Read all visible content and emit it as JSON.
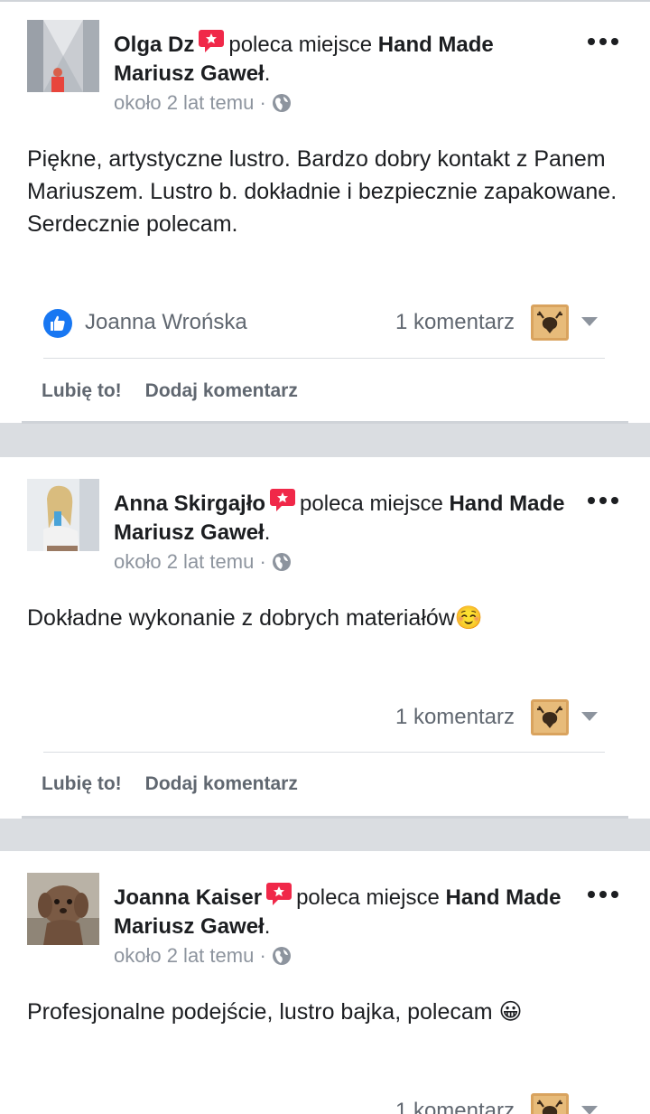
{
  "posts": [
    {
      "author": "Olga Dz",
      "recommends": "poleca miejsce",
      "page": "Hand Made Mariusz Gaweł",
      "time": "około 2 lat temu",
      "text": "Piękne, artystyczne lustro. Bardzo dobry kontakt z Panem Mariuszem. Lustro b. dokładnie i bezpiecznie zapakowane. Serdecznie polecam.",
      "reactor": "Joanna Wrońska",
      "comments": "1 komentarz"
    },
    {
      "author": "Anna Skirgajło",
      "recommends": "poleca miejsce",
      "page": "Hand Made Mariusz Gaweł",
      "time": "około 2 lat temu",
      "text": "Dokładne wykonanie z dobrych materiałów☺️",
      "reactor": "",
      "comments": "1 komentarz"
    },
    {
      "author": "Joanna Kaiser",
      "recommends": "poleca miejsce",
      "page": "Hand Made Mariusz Gaweł",
      "time": "około 2 lat temu",
      "text": "Profesjonalne podejście, lustro bajka, polecam 😀",
      "reactor": "",
      "comments": "1 komentarz"
    }
  ],
  "actions": {
    "like": "Lubię to!",
    "comment": "Dodaj komentarz"
  },
  "separators": {
    "dot": "·",
    "period": "."
  },
  "colors": {
    "badge": "#f02849",
    "like": "#1877f2",
    "muted": "#606770",
    "meta": "#8d949e",
    "feed_bg": "#dadde1"
  },
  "icons": [
    "recommendation-badge-icon",
    "globe-icon",
    "more-options-icon",
    "like-reaction-icon",
    "page-thumbnail-icon",
    "chevron-down-icon"
  ]
}
